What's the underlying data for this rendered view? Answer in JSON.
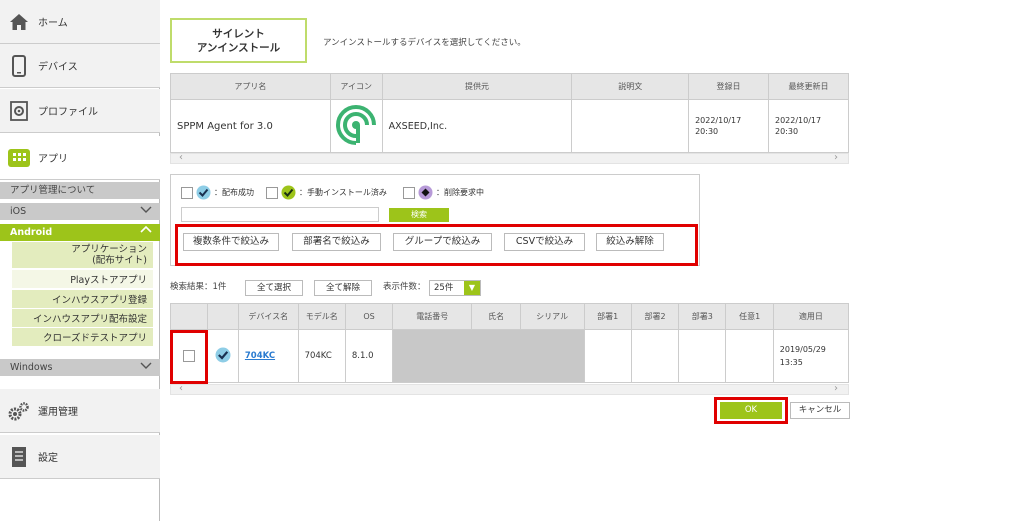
{
  "sidebar": {
    "home": "ホーム",
    "devices": "デバイス",
    "profiles": "プロファイル",
    "apps": "アプリ",
    "about_app_mgmt": "アプリ管理について",
    "ios": "iOS",
    "android": "Android",
    "android_items": [
      "アプリケーション\n(配布サイト)",
      "Playストアアプリ",
      "インハウスアプリ登録",
      "インハウスアプリ配布設定",
      "クローズドテストアプリ"
    ],
    "windows": "Windows",
    "operations": "運用管理",
    "settings": "設定"
  },
  "page": {
    "title_line1": "サイレント",
    "title_line2": "アンインストール",
    "description": "アンインストールするデバイスを選択してください。"
  },
  "app_table": {
    "headers": [
      "アプリ名",
      "アイコン",
      "提供元",
      "説明文",
      "登録日",
      "最終更新日"
    ],
    "row": {
      "name": "SPPM Agent for 3.0",
      "provider": "AXSEED,Inc.",
      "description": "",
      "registered": "2022/10/17\n20:30",
      "updated": "2022/10/17\n20:30"
    }
  },
  "filter": {
    "legend_distributed": "：配布成功",
    "legend_manual": "：手動インストール済み",
    "legend_delete": "：削除要求中",
    "search_placeholder": "",
    "search_button": "検索",
    "buttons": [
      "複数条件で絞込み",
      "部署名で絞込み",
      "グループで絞込み",
      "CSVで絞込み",
      "絞込み解除"
    ]
  },
  "results": {
    "count_label": "検索結果：1件",
    "select_all": "全て選択",
    "deselect_all": "全て解除",
    "page_size_label": "表示件数：",
    "page_size": "25件"
  },
  "device_table": {
    "headers": [
      "",
      "",
      "デバイス名",
      "モデル名",
      "OS",
      "電話番号",
      "氏名",
      "シリアル",
      "部署1",
      "部署2",
      "部署3",
      "任意1",
      "適用日"
    ],
    "row": {
      "device_name": "704KC",
      "model": "704KC",
      "os": "8.1.0",
      "applied_date": "2019/05/29\n13:35"
    }
  },
  "actions": {
    "ok": "OK",
    "cancel": "キャンセル"
  },
  "colors": {
    "accent": "#9dc41a",
    "highlight": "#e00000"
  }
}
